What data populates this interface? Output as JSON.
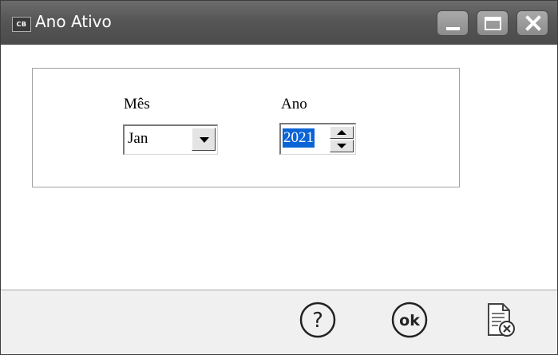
{
  "window": {
    "app_icon_text": "CB",
    "title": "Ano Ativo",
    "controls": [
      "minimize-icon",
      "maximize-icon",
      "close-icon"
    ]
  },
  "form": {
    "month_label": "Mês",
    "month_value": "Jan",
    "year_label": "Ano",
    "year_value": "2021"
  },
  "footer": {
    "buttons": [
      {
        "icon": "help-icon",
        "glyph_text": "?"
      },
      {
        "icon": "ok-icon",
        "glyph_text": "ok"
      },
      {
        "icon": "cancel-document-icon"
      }
    ]
  },
  "colors": {
    "titlebar": "#565656",
    "selection": "#0a64d6",
    "footer_bg": "#f0f0f0"
  }
}
